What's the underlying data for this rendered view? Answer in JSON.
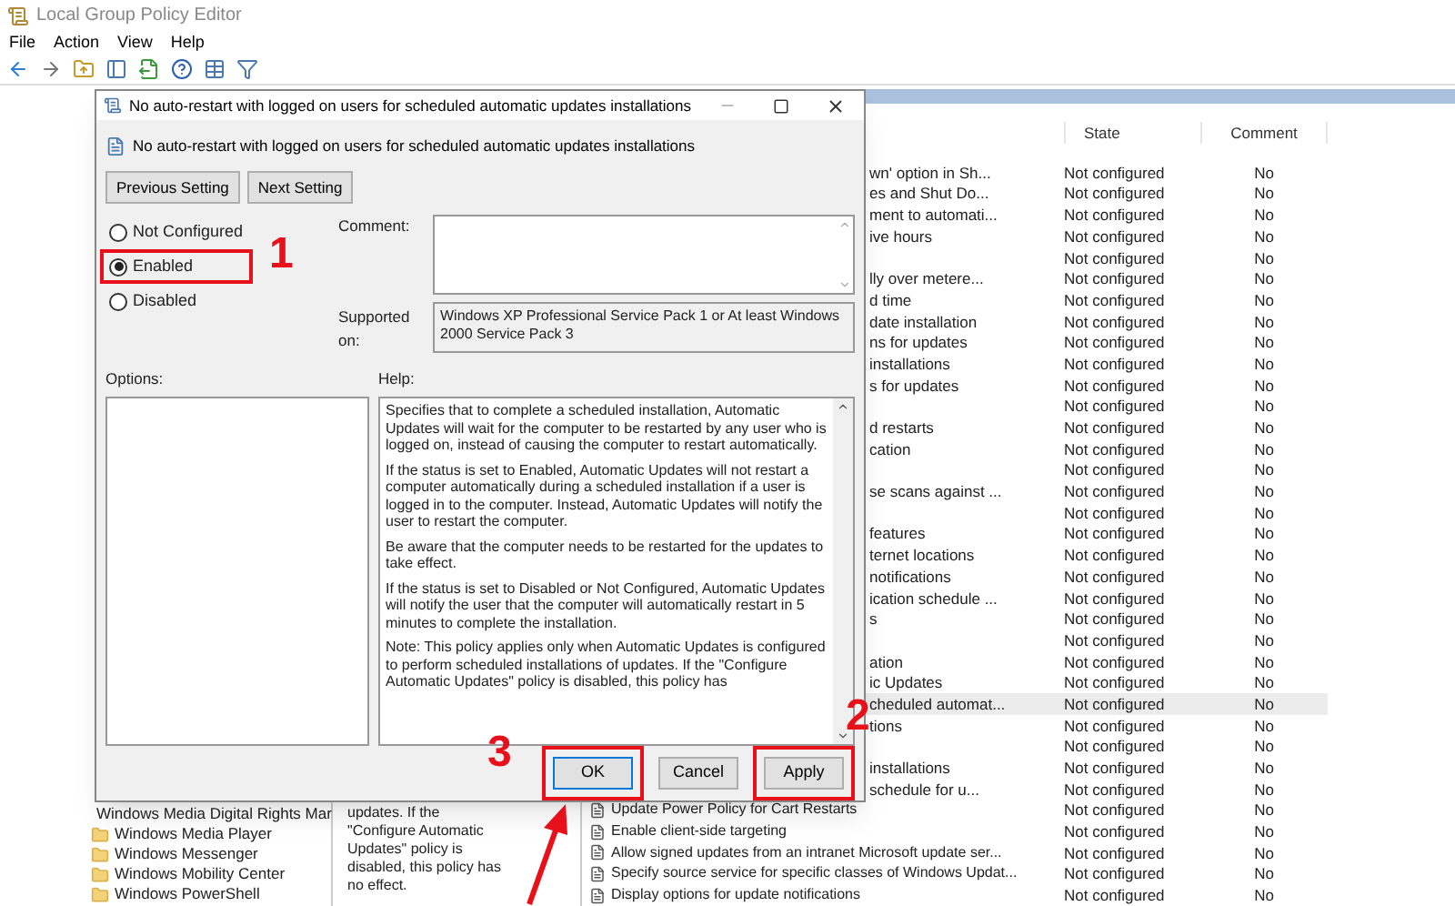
{
  "window": {
    "title": "Local Group Policy Editor"
  },
  "menu": [
    "File",
    "Action",
    "View",
    "Help"
  ],
  "tree": {
    "items": [
      {
        "label": "Windows Media Digital Rights Mar"
      },
      {
        "label": "Windows Media Player"
      },
      {
        "label": "Windows Messenger"
      },
      {
        "label": "Windows Mobility Center"
      },
      {
        "label": "Windows PowerShell"
      }
    ]
  },
  "description": {
    "text": "updates. If the \"Configure Automatic Updates\" policy is disabled, this policy has no effect."
  },
  "settings_list": {
    "columns": [
      "State",
      "Comment"
    ],
    "rows": [
      {
        "kind": "clipped",
        "name": "wn' option in Sh...",
        "state": "Not configured",
        "comment": "No",
        "selected": false
      },
      {
        "kind": "clipped",
        "name": "es and Shut Do...",
        "state": "Not configured",
        "comment": "No",
        "selected": false
      },
      {
        "kind": "clipped",
        "name": "ment to automati...",
        "state": "Not configured",
        "comment": "No",
        "selected": false
      },
      {
        "kind": "clipped",
        "name": "ive hours",
        "state": "Not configured",
        "comment": "No",
        "selected": false
      },
      {
        "kind": "clipped",
        "state": "Not configured",
        "comment": "No",
        "selected": false
      },
      {
        "kind": "clipped",
        "name": "lly over metere...",
        "state": "Not configured",
        "comment": "No",
        "selected": false
      },
      {
        "kind": "clipped",
        "name": "d time",
        "state": "Not configured",
        "comment": "No",
        "selected": false
      },
      {
        "kind": "clipped",
        "name": "date installation",
        "state": "Not configured",
        "comment": "No",
        "selected": false
      },
      {
        "kind": "clipped",
        "name": "ns for updates",
        "state": "Not configured",
        "comment": "No",
        "selected": false
      },
      {
        "kind": "clipped",
        "name": "installations",
        "state": "Not configured",
        "comment": "No",
        "selected": false
      },
      {
        "kind": "clipped",
        "name": "s for updates",
        "state": "Not configured",
        "comment": "No",
        "selected": false
      },
      {
        "kind": "clipped",
        "state": "Not configured",
        "comment": "No",
        "selected": false
      },
      {
        "kind": "clipped",
        "name": "d restarts",
        "state": "Not configured",
        "comment": "No",
        "selected": false
      },
      {
        "kind": "clipped",
        "name": "cation",
        "state": "Not configured",
        "comment": "No",
        "selected": false
      },
      {
        "kind": "clipped",
        "state": "Not configured",
        "comment": "No",
        "selected": false
      },
      {
        "kind": "clipped",
        "name": "se scans against ...",
        "state": "Not configured",
        "comment": "No",
        "selected": false
      },
      {
        "kind": "clipped",
        "state": "Not configured",
        "comment": "No",
        "selected": false
      },
      {
        "kind": "clipped",
        "name": "features",
        "state": "Not configured",
        "comment": "No",
        "selected": false
      },
      {
        "kind": "clipped",
        "name": "ternet locations",
        "state": "Not configured",
        "comment": "No",
        "selected": false
      },
      {
        "kind": "clipped",
        "name": "notifications",
        "state": "Not configured",
        "comment": "No",
        "selected": false
      },
      {
        "kind": "clipped",
        "name": "ication schedule ...",
        "state": "Not configured",
        "comment": "No",
        "selected": false
      },
      {
        "kind": "clipped",
        "name": "s",
        "state": "Not configured",
        "comment": "No",
        "selected": false
      },
      {
        "kind": "clipped",
        "state": "Not configured",
        "comment": "No",
        "selected": false
      },
      {
        "kind": "clipped",
        "name": "ation",
        "state": "Not configured",
        "comment": "No",
        "selected": false
      },
      {
        "kind": "clipped",
        "name": "ic Updates",
        "state": "Not configured",
        "comment": "No",
        "selected": false
      },
      {
        "kind": "clipped",
        "name": "cheduled automat...",
        "state": "Not configured",
        "comment": "No",
        "selected": true
      },
      {
        "kind": "clipped",
        "name": "tions",
        "state": "Not configured",
        "comment": "No",
        "selected": false
      },
      {
        "kind": "clipped",
        "state": "Not configured",
        "comment": "No",
        "selected": false
      },
      {
        "kind": "clipped",
        "name": "installations",
        "state": "Not configured",
        "comment": "No",
        "selected": false
      },
      {
        "kind": "clipped",
        "name": "schedule for u...",
        "state": "Not configured",
        "comment": "No",
        "selected": false
      },
      {
        "kind": "full",
        "name": "Update Power Policy for Cart Restarts",
        "state": "Not configured",
        "comment": "No",
        "selected": false
      },
      {
        "kind": "full",
        "name": "Enable client-side targeting",
        "state": "Not configured",
        "comment": "No",
        "selected": false
      },
      {
        "kind": "full",
        "name": "Allow signed updates from an intranet Microsoft update ser...",
        "state": "Not configured",
        "comment": "No",
        "selected": false
      },
      {
        "kind": "full",
        "name": "Specify source service for specific classes of Windows Updat...",
        "state": "Not configured",
        "comment": "No",
        "selected": false
      },
      {
        "kind": "full",
        "name": "Display options for update notifications",
        "state": "Not configured",
        "comment": "No",
        "selected": false
      }
    ]
  },
  "dialog": {
    "title": "No auto-restart with logged on users for scheduled automatic updates installations",
    "heading": "No auto-restart with logged on users for scheduled automatic updates installations",
    "nav_buttons": [
      "Previous Setting",
      "Next Setting"
    ],
    "options": [
      {
        "label": "Not Configured",
        "selected": false,
        "annotated": false
      },
      {
        "label": "Enabled",
        "selected": true,
        "annotated": true
      },
      {
        "label": "Disabled",
        "selected": false,
        "annotated": false
      }
    ],
    "comment_label": "Comment:",
    "supported_label": "Supported on:",
    "supported_value": "Windows XP Professional Service Pack 1 or At least Windows 2000 Service Pack 3",
    "options_label": "Options:",
    "help_label": "Help:",
    "help_paragraphs": [
      "Specifies that to complete a scheduled installation, Automatic Updates will wait for the computer to be restarted by any user who is logged on, instead of causing the computer to restart automatically.",
      "If the status is set to Enabled, Automatic Updates will not restart a computer automatically during a scheduled installation if a user is logged in to the computer. Instead, Automatic Updates will notify the user to restart the computer.",
      "Be aware that the computer needs to be restarted for the updates to take effect.",
      "If the status is set to Disabled or Not Configured, Automatic Updates will notify the user that the computer will automatically restart in 5 minutes to complete the installation.",
      "Note: This policy applies only when Automatic Updates is configured to perform scheduled installations of updates. If the \"Configure Automatic Updates\" policy is disabled, this policy has"
    ],
    "buttons": [
      {
        "label": "OK",
        "annotated": true,
        "default": true
      },
      {
        "label": "Cancel",
        "annotated": false,
        "default": false
      },
      {
        "label": "Apply",
        "annotated": true,
        "default": false
      }
    ]
  },
  "annotations": [
    {
      "label": "1"
    },
    {
      "label": "2"
    },
    {
      "label": "3"
    }
  ]
}
